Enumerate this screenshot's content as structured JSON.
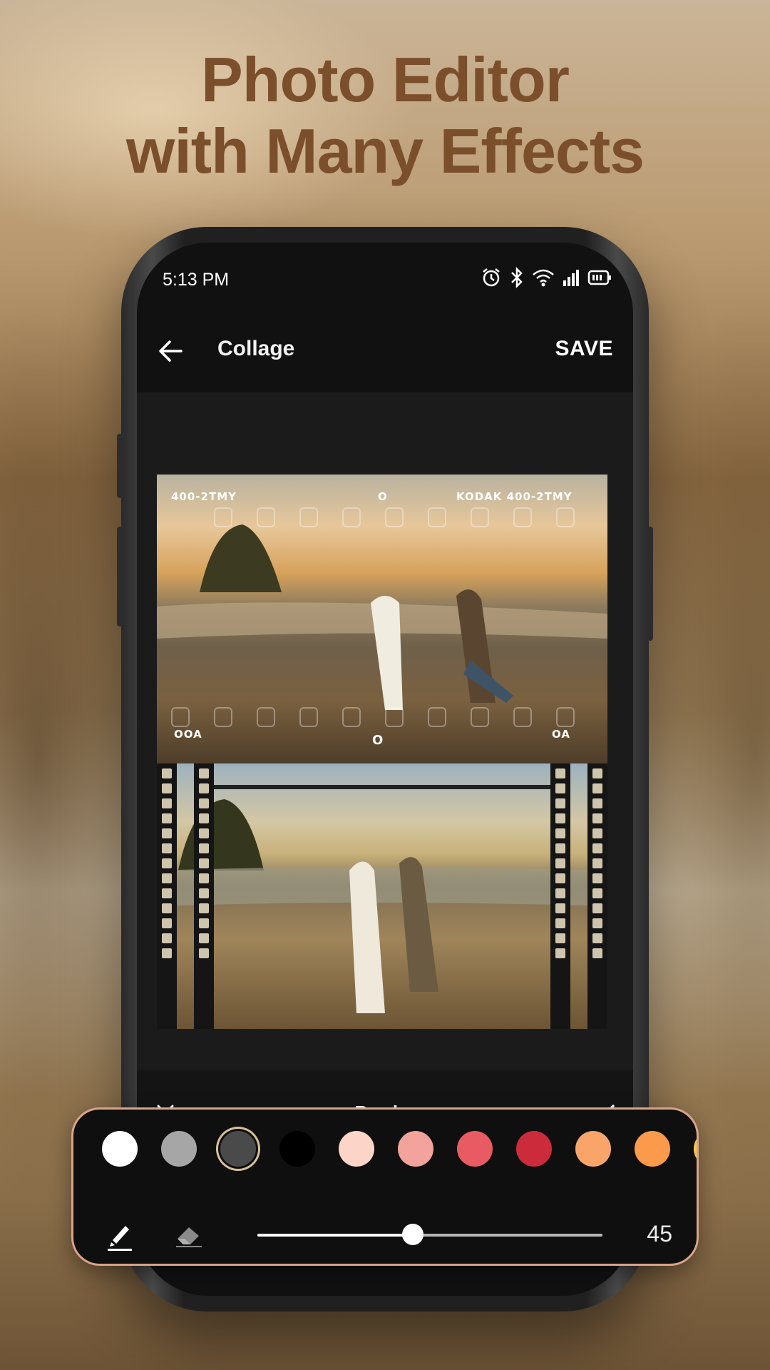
{
  "promo": {
    "headline_line1": "Photo Editor",
    "headline_line2": "with Many Effects"
  },
  "status_bar": {
    "time": "5:13 PM",
    "icons": [
      "alarm-icon",
      "bluetooth-icon",
      "wifi-icon",
      "signal-icon",
      "battery-icon"
    ]
  },
  "app_bar": {
    "back_icon": "arrow-left-icon",
    "title": "Collage",
    "save_label": "SAVE"
  },
  "collage": {
    "photo1": {
      "film_top_left": "400-2TMY",
      "film_top_center": "O",
      "film_top_right": "KODAK 400-2TMY",
      "film_bottom_left": "OOA",
      "film_bottom_center": "O",
      "film_bottom_right": "OA"
    },
    "photo2": {}
  },
  "bottom_toolbar": {
    "close_icon": "close-icon",
    "title": "Border",
    "confirm_icon": "check-icon"
  },
  "border_panel": {
    "colors": [
      "#ffffff",
      "#a6a6a6",
      "#4a4a4a",
      "#000000",
      "#fdd5c8",
      "#f2a39b",
      "#e95b62",
      "#cc2b3c",
      "#f9a56a",
      "#fb9a4a",
      "#f5c84b"
    ],
    "selected_color_index": 2,
    "tools": [
      "brush-icon",
      "eraser-icon"
    ],
    "selected_tool": "brush-icon",
    "width_value": 45,
    "width_min": 0,
    "width_max": 100,
    "width_label": "45"
  },
  "accent_colors": {
    "headline": "#7b4f2c",
    "panel_border": "#d9a48a"
  }
}
